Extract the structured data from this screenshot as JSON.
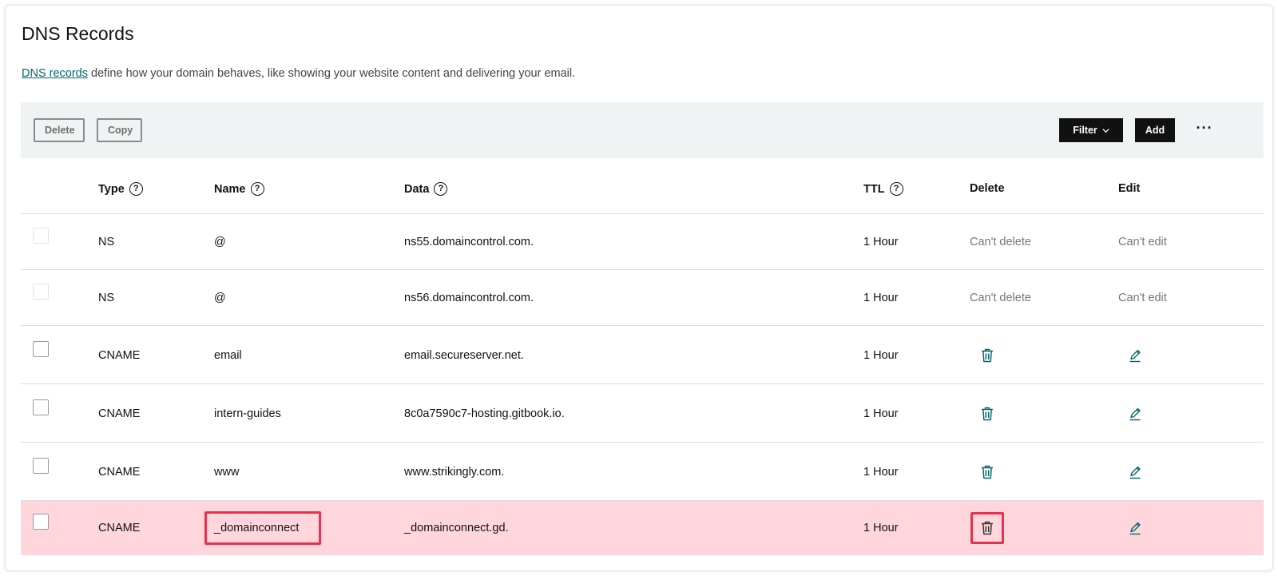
{
  "page": {
    "title": "DNS Records",
    "intro_link": "DNS records",
    "intro_rest": " define how your domain behaves, like showing your website content and delivering your email."
  },
  "toolbar": {
    "delete_label": "Delete",
    "copy_label": "Copy",
    "filter_label": "Filter",
    "add_label": "Add",
    "more_label": "···"
  },
  "columns": {
    "type": "Type",
    "name": "Name",
    "data": "Data",
    "ttl": "TTL",
    "delete": "Delete",
    "edit": "Edit",
    "help_glyph": "?"
  },
  "rows": [
    {
      "type": "NS",
      "name": "@",
      "data": "ns55.domaincontrol.com.",
      "ttl": "1 Hour",
      "delete": "Can't delete",
      "edit": "Can't edit",
      "editable": false
    },
    {
      "type": "NS",
      "name": "@",
      "data": "ns56.domaincontrol.com.",
      "ttl": "1 Hour",
      "delete": "Can't delete",
      "edit": "Can't edit",
      "editable": false
    },
    {
      "type": "CNAME",
      "name": "email",
      "data": "email.secureserver.net.",
      "ttl": "1 Hour",
      "editable": true
    },
    {
      "type": "CNAME",
      "name": "intern-guides",
      "data": "8c0a7590c7-hosting.gitbook.io.",
      "ttl": "1 Hour",
      "editable": true
    },
    {
      "type": "CNAME",
      "name": "www",
      "data": "www.strikingly.com.",
      "ttl": "1 Hour",
      "editable": true
    },
    {
      "type": "CNAME",
      "name": "_domainconnect",
      "data": "_domainconnect.gd.",
      "ttl": "1 Hour",
      "editable": true,
      "highlighted": true
    }
  ],
  "icons": {
    "delete": "trash-icon",
    "edit": "pencil-icon",
    "filter": "chevron-down-icon",
    "help": "question-circle-icon"
  },
  "colors": {
    "accent": "#00686e",
    "highlight_row": "#ffd6db",
    "highlight_box": "#e8304f",
    "toolbar_bg": "#f0f3f4"
  }
}
